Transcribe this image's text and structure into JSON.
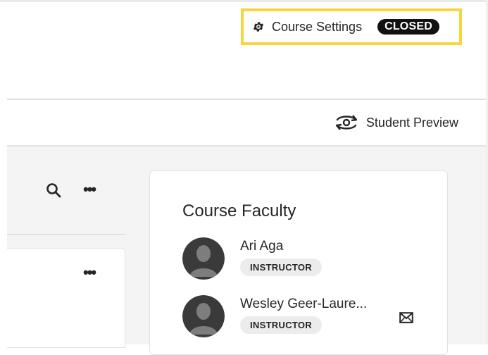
{
  "header": {
    "settings_label": "Course Settings",
    "status_badge": "CLOSED",
    "highlight_color": "#f7d53b"
  },
  "toolbar": {
    "student_preview_label": "Student Preview"
  },
  "list": {
    "more_label": "•••",
    "card_more_label": "•••"
  },
  "faculty": {
    "title": "Course Faculty",
    "members": [
      {
        "name": "Ari Aga",
        "role": "INSTRUCTOR"
      },
      {
        "name": "Wesley Geer-Laure...",
        "role": "INSTRUCTOR"
      }
    ]
  },
  "icons": {
    "settings": "gear-icon",
    "preview": "eye-refresh-icon",
    "search": "search-icon",
    "mail": "mail-icon"
  }
}
